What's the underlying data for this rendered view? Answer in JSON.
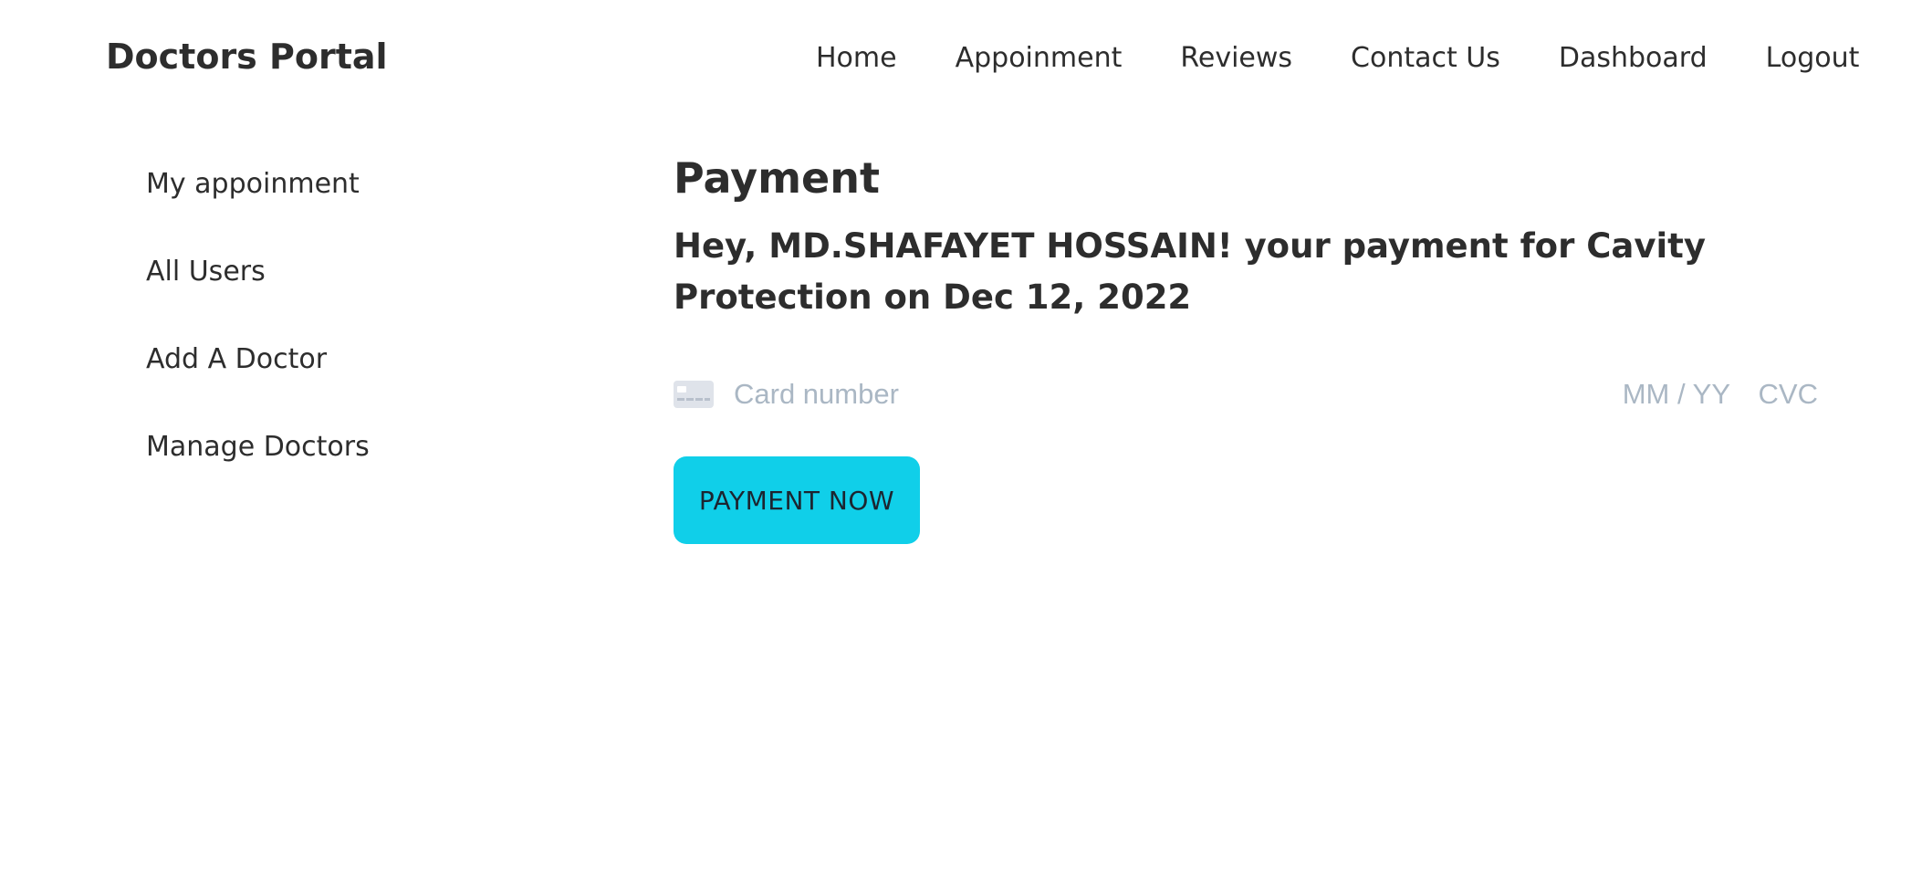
{
  "navbar": {
    "brand": "Doctors Portal",
    "links": [
      {
        "label": "Home"
      },
      {
        "label": "Appoinment"
      },
      {
        "label": "Reviews"
      },
      {
        "label": "Contact Us"
      },
      {
        "label": "Dashboard"
      },
      {
        "label": "Logout"
      }
    ]
  },
  "sidebar": {
    "items": [
      {
        "label": "My appoinment"
      },
      {
        "label": "All Users"
      },
      {
        "label": "Add A Doctor"
      },
      {
        "label": "Manage Doctors"
      }
    ]
  },
  "main": {
    "title": "Payment",
    "greeting": "Hey, MD.SHAFAYET HOSSAIN! your payment for Cavity Protection on Dec 12, 2022",
    "card": {
      "icon": "credit-card-icon",
      "number_placeholder": "Card number",
      "expiry_placeholder": "MM / YY",
      "cvc_placeholder": "CVC"
    },
    "pay_button_label": "PAYMENT NOW"
  },
  "colors": {
    "accent": "#10cfe9",
    "placeholder": "#aab7c4",
    "text": "#2d2d2d"
  }
}
